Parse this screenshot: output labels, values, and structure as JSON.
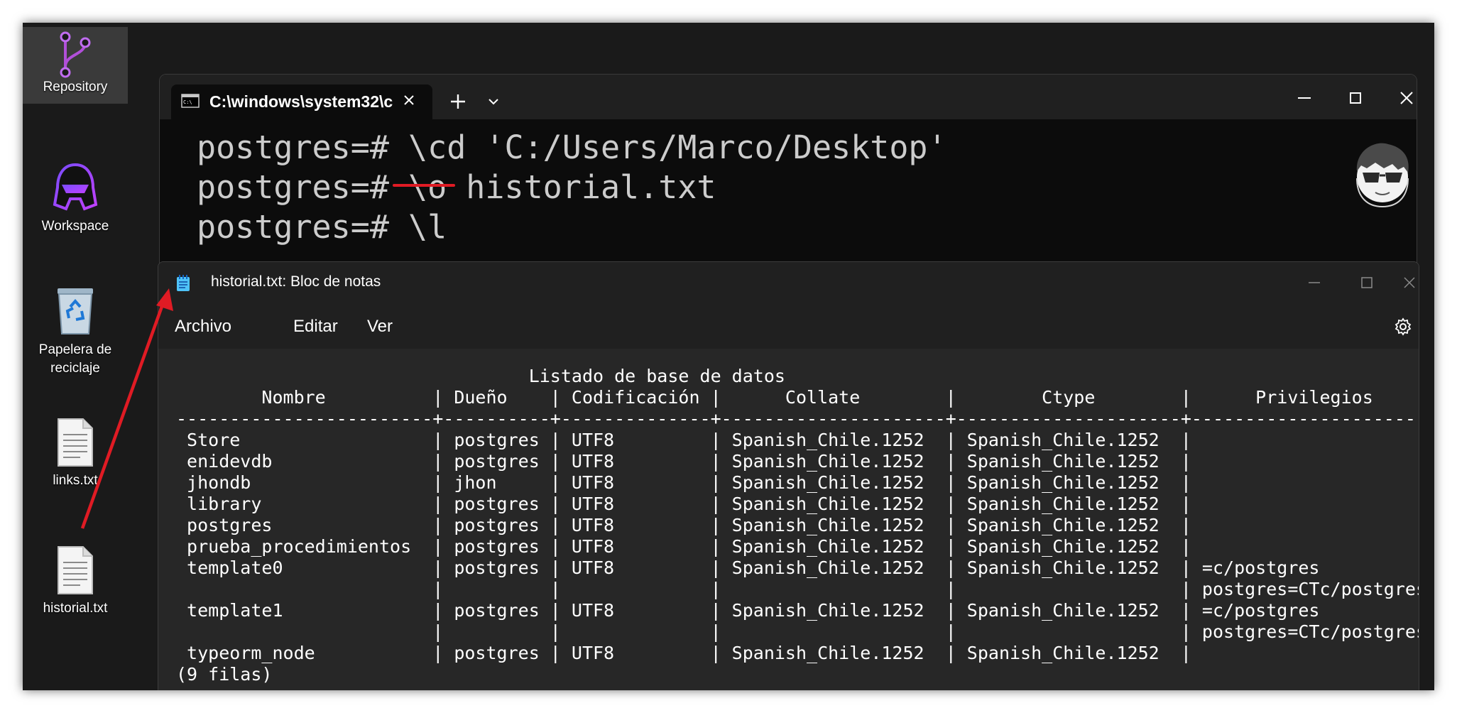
{
  "desktop": {
    "icons": [
      {
        "label": "Repository",
        "icon": "git-branch-icon"
      },
      {
        "label": "Workspace",
        "icon": "helmet-icon"
      },
      {
        "label": "Papelera de reciclaje",
        "icon": "recycle-bin-icon"
      },
      {
        "label": "links.txt",
        "icon": "text-file-icon"
      },
      {
        "label": "historial.txt",
        "icon": "text-file-icon"
      }
    ]
  },
  "terminal": {
    "tab_title": "C:\\windows\\system32\\c",
    "new_tab_label": "+",
    "lines": [
      "postgres=# \\cd 'C:/Users/Marco/Desktop'",
      "postgres=# \\o historial.txt",
      "postgres=# \\l"
    ]
  },
  "notepad": {
    "title": "historial.txt: Bloc de notas",
    "menu": [
      "Archivo",
      "Editar",
      "Ver"
    ],
    "content": "                                 Listado de base de datos\n        Nombre          | Dueño    | Codificación |      Collate        |        Ctype        |      Privilegios\n------------------------+----------+--------------+---------------------+---------------------+-----------------------\n Store                  | postgres | UTF8         | Spanish_Chile.1252  | Spanish_Chile.1252  |\n enidevdb               | postgres | UTF8         | Spanish_Chile.1252  | Spanish_Chile.1252  |\n jhondb                 | jhon     | UTF8         | Spanish_Chile.1252  | Spanish_Chile.1252  |\n library                | postgres | UTF8         | Spanish_Chile.1252  | Spanish_Chile.1252  |\n postgres               | postgres | UTF8         | Spanish_Chile.1252  | Spanish_Chile.1252  |\n prueba_procedimientos  | postgres | UTF8         | Spanish_Chile.1252  | Spanish_Chile.1252  |\n template0              | postgres | UTF8         | Spanish_Chile.1252  | Spanish_Chile.1252  | =c/postgres          +\n                        |          |              |                     |                     | postgres=CTc/postgres\n template1              | postgres | UTF8         | Spanish_Chile.1252  | Spanish_Chile.1252  | =c/postgres          +\n                        |          |              |                     |                     | postgres=CTc/postgres\n typeorm_node           | postgres | UTF8         | Spanish_Chile.1252  | Spanish_Chile.1252  |\n(9 filas)"
  },
  "colors": {
    "desktop_bg": "#1a1a1a",
    "terminal_bg": "#0c0c0c",
    "notepad_bg": "#272727",
    "annotation_red": "#e01b24"
  }
}
